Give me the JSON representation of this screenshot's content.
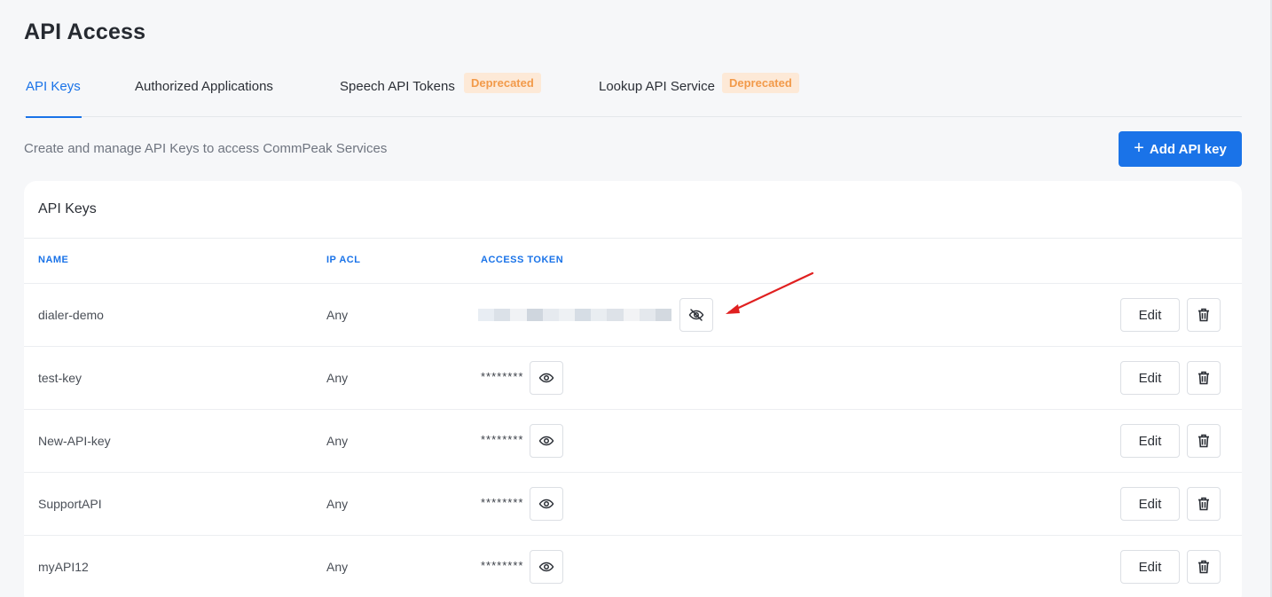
{
  "page": {
    "title": "API Access",
    "subtitle": "Create and manage API Keys to access CommPeak Services",
    "add_button": {
      "plus": "+",
      "label": "Add API key"
    }
  },
  "tabs": [
    {
      "label": "API Keys",
      "active": true
    },
    {
      "label": "Authorized Applications",
      "active": false
    },
    {
      "label": "Speech API Tokens",
      "badge": "Deprecated",
      "active": false
    },
    {
      "label": "Lookup API Service",
      "badge": "Deprecated",
      "active": false
    }
  ],
  "table": {
    "title": "API Keys",
    "columns": {
      "name": "NAME",
      "ip_acl": "IP ACL",
      "access_token": "ACCESS TOKEN"
    },
    "edit_label": "Edit",
    "rows": [
      {
        "name": "dialer-demo",
        "ip_acl": "Any",
        "token": "",
        "token_revealed": true,
        "toggle_icon": "eye-off-icon"
      },
      {
        "name": "test-key",
        "ip_acl": "Any",
        "token": "********",
        "token_revealed": false,
        "toggle_icon": "eye-icon"
      },
      {
        "name": "New-API-key",
        "ip_acl": "Any",
        "token": "********",
        "token_revealed": false,
        "toggle_icon": "eye-icon"
      },
      {
        "name": "SupportAPI",
        "ip_acl": "Any",
        "token": "********",
        "token_revealed": false,
        "toggle_icon": "eye-icon"
      },
      {
        "name": "myAPI12",
        "ip_acl": "Any",
        "token": "********",
        "token_revealed": false,
        "toggle_icon": "eye-icon"
      }
    ]
  },
  "colors": {
    "accent": "#1a73e8",
    "badge_bg": "#fde9d7",
    "badge_text": "#f29a4a",
    "annotation_arrow": "#e02020"
  }
}
